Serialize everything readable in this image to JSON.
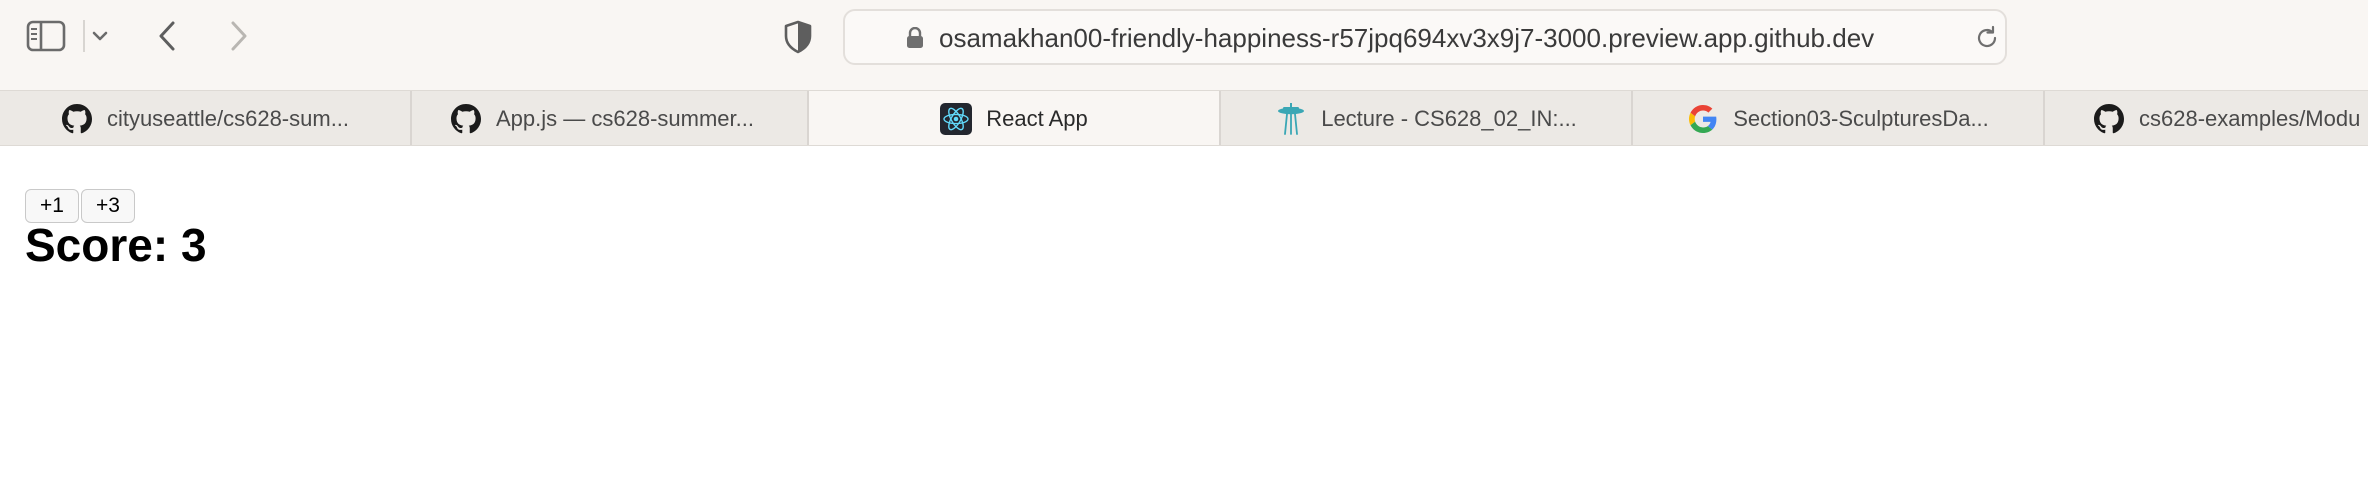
{
  "browser": {
    "url": "osamakhan00-friendly-happiness-r57jpq694xv3x9j7-3000.preview.app.github.dev",
    "tabs": [
      {
        "label": "cityuseattle/cs628-sum...",
        "icon": "github-icon",
        "active": false
      },
      {
        "label": "App.js — cs628-summer...",
        "icon": "github-icon",
        "active": false
      },
      {
        "label": "React App",
        "icon": "react-icon",
        "active": true
      },
      {
        "label": "Lecture - CS628_02_IN:...",
        "icon": "space-needle-icon",
        "active": false
      },
      {
        "label": "Section03-SculpturesDa...",
        "icon": "google-icon",
        "active": false
      },
      {
        "label": "cs628-examples/Modu",
        "icon": "github-icon",
        "active": false
      }
    ]
  },
  "app": {
    "buttons": [
      "+1",
      "+3"
    ],
    "score_label": "Score: 3"
  },
  "colors": {
    "toolbar_bg": "#f9f6f3",
    "tabstrip_bg": "#ece9e5",
    "react_accent": "#61dafb"
  }
}
